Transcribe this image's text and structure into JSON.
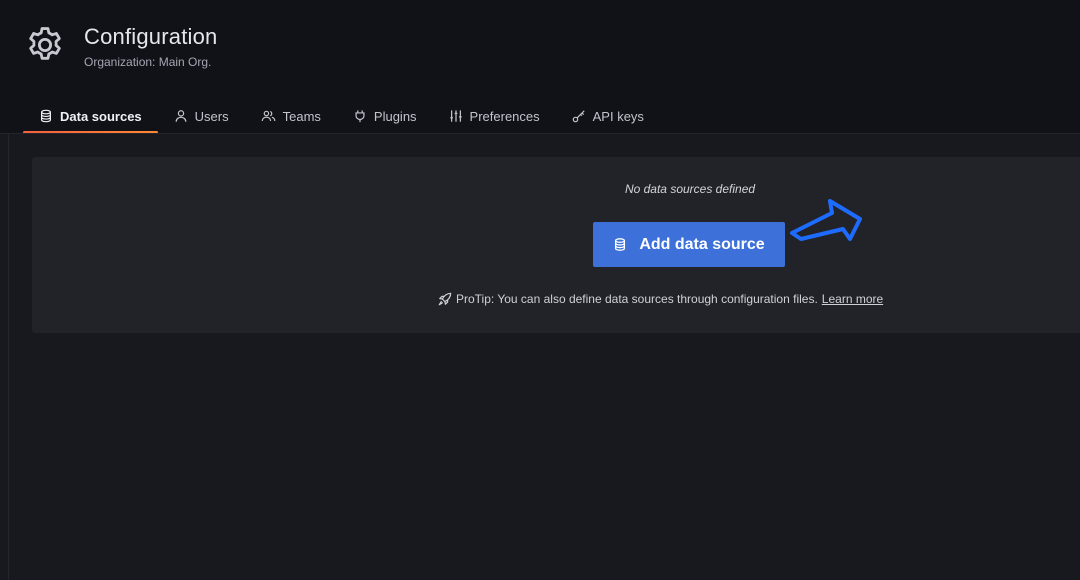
{
  "header": {
    "title": "Configuration",
    "subtitle": "Organization: Main Org.",
    "icon": "gear-icon"
  },
  "tabs": [
    {
      "label": "Data sources",
      "icon": "database-icon",
      "active": true
    },
    {
      "label": "Users",
      "icon": "user-icon",
      "active": false
    },
    {
      "label": "Teams",
      "icon": "users-icon",
      "active": false
    },
    {
      "label": "Plugins",
      "icon": "plug-icon",
      "active": false
    },
    {
      "label": "Preferences",
      "icon": "sliders-icon",
      "active": false
    },
    {
      "label": "API keys",
      "icon": "key-icon",
      "active": false
    }
  ],
  "empty_state": {
    "message": "No data sources defined",
    "button_label": "Add data source",
    "button_icon": "database-icon",
    "protip_text": "ProTip: You can also define data sources through configuration files.",
    "learn_more": "Learn more",
    "protip_icon": "rocket-icon"
  },
  "colors": {
    "background": "#111217",
    "panel": "#222328",
    "primary_button": "#3d71d9",
    "tab_underline": "#f55f3e",
    "annotation_arrow": "#1e6cff"
  }
}
